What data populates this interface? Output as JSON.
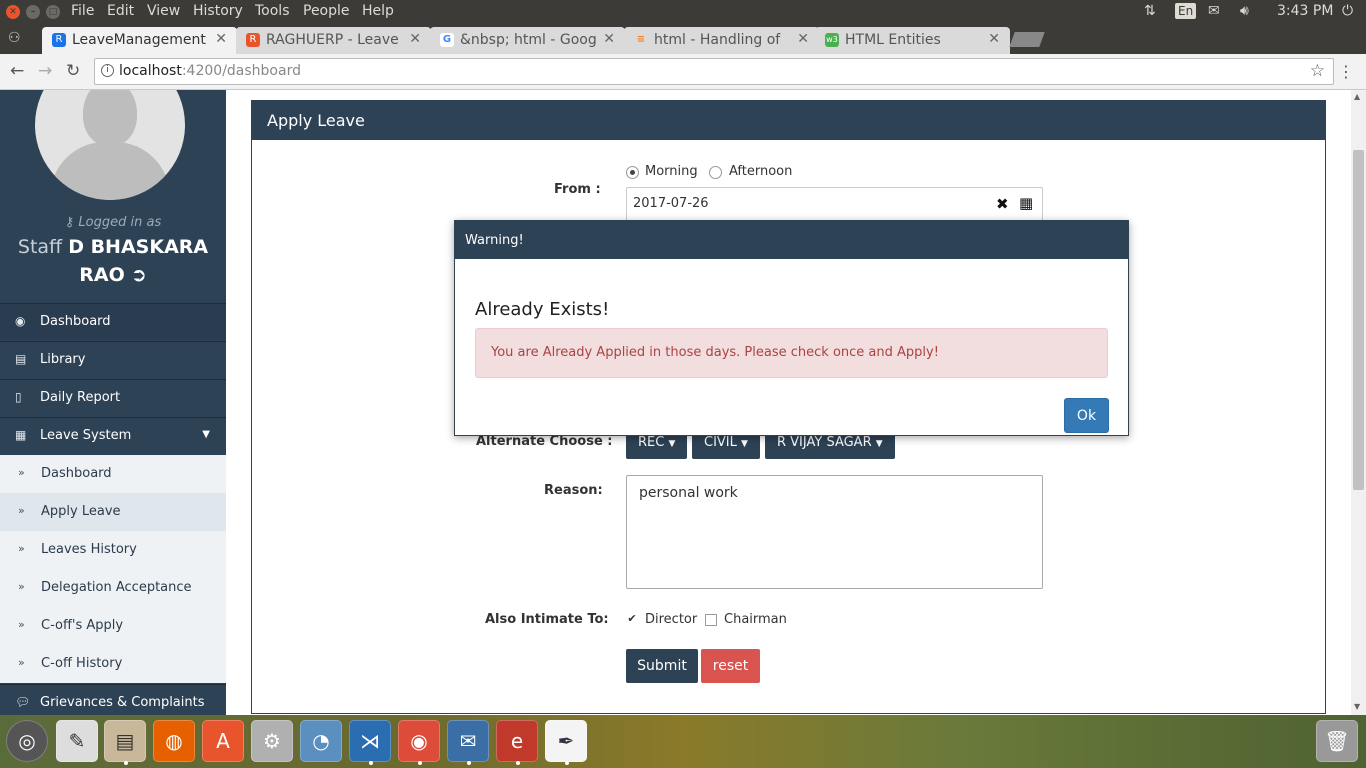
{
  "os": {
    "menu": [
      "File",
      "Edit",
      "View",
      "History",
      "Tools",
      "People",
      "Help"
    ],
    "keyboard_layout": "En",
    "time": "3:43 PM"
  },
  "tabs": [
    {
      "title": "LeaveManagement",
      "favicon": "leave-app-icon",
      "favicon_text": "R",
      "color": "#1a73e8",
      "active": true
    },
    {
      "title": "RAGHUERP - Leave",
      "favicon": "erp-icon",
      "favicon_text": "R",
      "color": "#e8542b",
      "active": false
    },
    {
      "title": "&nbsp; html - Goog",
      "favicon": "google-icon",
      "favicon_text": "G",
      "color": "#4285f4",
      "active": false
    },
    {
      "title": "html - Handling of",
      "favicon": "stackoverflow-icon",
      "favicon_text": "≡",
      "color": "#f48024",
      "active": false
    },
    {
      "title": "HTML Entities",
      "favicon": "w3-icon",
      "favicon_text": "w3",
      "color": "#4caf50",
      "active": false
    }
  ],
  "address": {
    "host": "localhost",
    "rest": ":4200/dashboard"
  },
  "sidebar": {
    "logged_in_label": "Logged in as",
    "role": "Staff",
    "name_line1": "D BHASKARA",
    "name_line2": "RAO",
    "items": [
      {
        "label": "Dashboard",
        "icon": "dashboard-icon"
      },
      {
        "label": "Library",
        "icon": "book-icon"
      },
      {
        "label": "Daily Report",
        "icon": "file-icon"
      },
      {
        "label": "Leave System",
        "icon": "calendar-icon"
      }
    ],
    "subitems": [
      {
        "label": "Dashboard"
      },
      {
        "label": "Apply Leave",
        "selected": true
      },
      {
        "label": "Leaves History"
      },
      {
        "label": "Delegation Acceptance"
      },
      {
        "label": "C-off's Apply"
      },
      {
        "label": "C-off History"
      }
    ],
    "bottom_item": {
      "label": "Grievances & Complaints",
      "icon": "comments-icon"
    }
  },
  "form": {
    "title": "Apply Leave",
    "from_label": "From :",
    "morning_label": "Morning",
    "afternoon_label": "Afternoon",
    "from_date": "2017-07-26",
    "alternate_label": "Alternate Choose :",
    "dropdowns": [
      "REC",
      "CIVIL",
      "R VIJAY SAGAR"
    ],
    "reason_label": "Reason:",
    "reason_value": "personal work",
    "intimate_label": "Also Intimate To:",
    "director_label": "Director",
    "director_checked": true,
    "chairman_label": "Chairman",
    "chairman_checked": false,
    "submit_label": "Submit",
    "reset_label": "reset"
  },
  "modal": {
    "header": "Warning!",
    "title": "Already Exists!",
    "message": "You are Already Applied in those days. Please check once and Apply!",
    "ok_label": "Ok"
  },
  "colors": {
    "brand": "#2e4256",
    "danger": "#d9534f",
    "primary": "#337ab7",
    "alert_bg": "#f2dede"
  }
}
